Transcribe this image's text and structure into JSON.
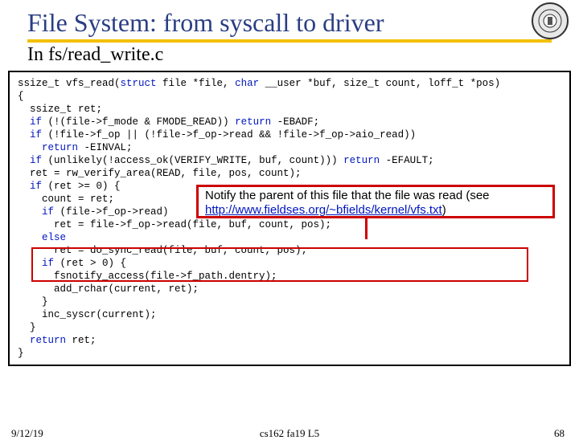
{
  "title": "File System: from syscall to driver",
  "subtitle": "In fs/read_write.c",
  "code": {
    "l1a": "ssize_t vfs_read(",
    "l1b": "struct",
    "l1c": " file *file, ",
    "l1d": "char",
    "l1e": " __user *buf, size_t count, loff_t *pos)",
    "l2": "{",
    "l3": "  ssize_t ret;",
    "l4a": "  ",
    "l4b": "if",
    "l4c": " (!(file->f_mode & FMODE_READ)) ",
    "l4d": "return",
    "l4e": " -EBADF;",
    "l5a": "  ",
    "l5b": "if",
    "l5c": " (!file->f_op || (!file->f_op->read && !file->f_op->aio_read))",
    "l6a": "    ",
    "l6b": "return",
    "l6c": " -EINVAL;",
    "l7a": "  ",
    "l7b": "if",
    "l7c": " (unlikely(!access_ok(VERIFY_WRITE, buf, count))) ",
    "l7d": "return",
    "l7e": " -EFAULT;",
    "l8": "  ret = rw_verify_area(READ, file, pos, count);",
    "l9a": "  ",
    "l9b": "if",
    "l9c": " (ret >= 0) {",
    "l10": "    count = ret;",
    "l11a": "    ",
    "l11b": "if",
    "l11c": " (file->f_op->read)",
    "l12": "      ret = file->f_op->read(file, buf, count, pos);",
    "l13a": "    ",
    "l13b": "else",
    "l14": "      ret = do_sync_read(file, buf, count, pos);",
    "l15a": "    ",
    "l15b": "if",
    "l15c": " (ret > 0) {",
    "l16": "      fsnotify_access(file->f_path.dentry);",
    "l17": "      add_rchar(current, ret);",
    "l18": "    }",
    "l19": "    inc_syscr(current);",
    "l20": "  }",
    "l21a": "  ",
    "l21b": "return",
    "l21c": " ret;",
    "l22": "}"
  },
  "callout": {
    "text1": "Notify the parent of this file that the file was read (see ",
    "link": "http://www.fieldses.org/~bfields/kernel/vfs.txt",
    "text2": ")"
  },
  "footer": {
    "date": "9/12/19",
    "center": "cs162 fa19 L5",
    "page": "68"
  }
}
